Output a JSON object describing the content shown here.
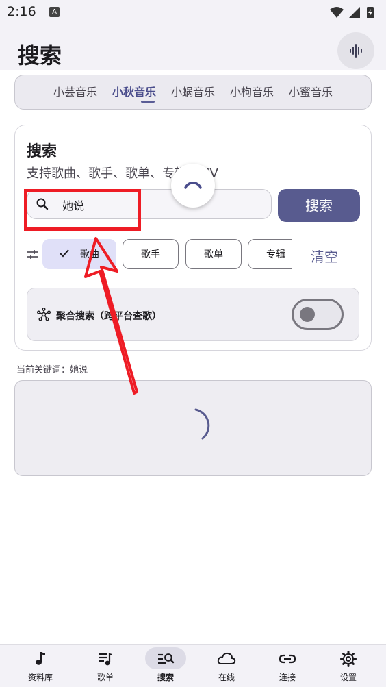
{
  "status_bar": {
    "time": "2:16",
    "notification_icon_text": "A"
  },
  "header": {
    "title": "搜索"
  },
  "sources": {
    "tabs": [
      {
        "label": "小芸音乐"
      },
      {
        "label": "小秋音乐"
      },
      {
        "label": "小蜗音乐"
      },
      {
        "label": "小枸音乐"
      },
      {
        "label": "小蜜音乐"
      }
    ],
    "active": "小秋音乐"
  },
  "search_card": {
    "title": "搜索",
    "subtitle": "支持歌曲、歌手、歌单、专辑、MV",
    "input_value": "她说",
    "search_button": "搜索",
    "chips": [
      {
        "label": "歌曲",
        "selected": true
      },
      {
        "label": "歌手",
        "selected": false
      },
      {
        "label": "歌单",
        "selected": false
      },
      {
        "label": "专辑",
        "selected": false
      }
    ],
    "clear_button": "清空",
    "aggregate": {
      "label": "聚合搜索（跨平台查歌）",
      "enabled": false
    }
  },
  "keyword": {
    "label": "当前关键词：",
    "value": "她说"
  },
  "bottom_nav": {
    "items": [
      {
        "label": "资料库",
        "icon": "music-note-icon"
      },
      {
        "label": "歌单",
        "icon": "playlist-icon"
      },
      {
        "label": "搜索",
        "icon": "search-list-icon",
        "active": true
      },
      {
        "label": "在线",
        "icon": "cloud-icon"
      },
      {
        "label": "连接",
        "icon": "link-icon"
      },
      {
        "label": "设置",
        "icon": "gear-icon"
      }
    ]
  },
  "colors": {
    "accent": "#585b8f",
    "annotation": "#ee1c25"
  }
}
